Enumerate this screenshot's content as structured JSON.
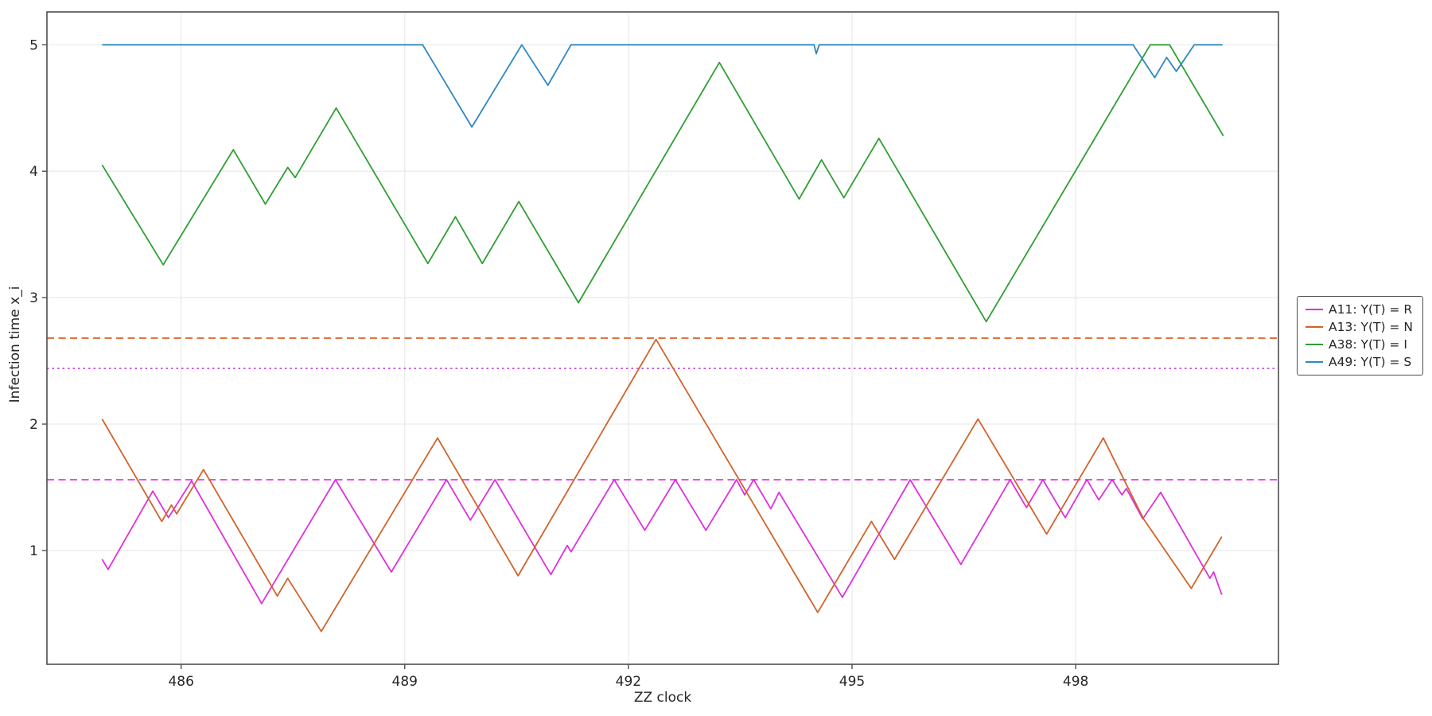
{
  "chart_data": {
    "type": "line",
    "title": "",
    "xlabel": "ZZ clock",
    "ylabel": "Infection time x_i",
    "xlim": [
      484.2,
      500.72
    ],
    "ylim": [
      0.1,
      5.26
    ],
    "xticks": [
      486,
      489,
      492,
      495,
      498
    ],
    "yticks": [
      1,
      2,
      3,
      4,
      5
    ],
    "grid": true,
    "legend_position": "right-outside",
    "colors": {
      "grid": "#e9e9e9",
      "axes_border": "#4d4d4d",
      "tick": "#4d4d4d",
      "text": "#262626"
    },
    "ref_lines": [
      {
        "y": 2.68,
        "color": "#da6227",
        "style": "dashed"
      },
      {
        "y": 2.44,
        "color": "#c44fdd",
        "style": "dotted"
      },
      {
        "y": 1.56,
        "color": "#e437e4",
        "style": "dashed"
      }
    ],
    "series": [
      {
        "name": "A11: Y(T) = R",
        "color": "#de30de",
        "points": [
          [
            484.94,
            0.93
          ],
          [
            485.02,
            0.85
          ],
          [
            485.62,
            1.47
          ],
          [
            485.83,
            1.26
          ],
          [
            486.14,
            1.55
          ],
          [
            487.08,
            0.58
          ],
          [
            488.07,
            1.56
          ],
          [
            488.82,
            0.83
          ],
          [
            489.56,
            1.56
          ],
          [
            489.88,
            1.24
          ],
          [
            490.21,
            1.56
          ],
          [
            490.96,
            0.81
          ],
          [
            491.18,
            1.04
          ],
          [
            491.23,
            0.99
          ],
          [
            491.81,
            1.56
          ],
          [
            492.22,
            1.16
          ],
          [
            492.63,
            1.56
          ],
          [
            493.04,
            1.16
          ],
          [
            493.45,
            1.56
          ],
          [
            493.56,
            1.44
          ],
          [
            493.68,
            1.56
          ],
          [
            493.91,
            1.33
          ],
          [
            494.02,
            1.46
          ],
          [
            494.87,
            0.63
          ],
          [
            495.78,
            1.56
          ],
          [
            496.46,
            0.89
          ],
          [
            497.12,
            1.56
          ],
          [
            497.34,
            1.34
          ],
          [
            497.56,
            1.56
          ],
          [
            497.86,
            1.26
          ],
          [
            498.15,
            1.56
          ],
          [
            498.31,
            1.4
          ],
          [
            498.49,
            1.56
          ],
          [
            498.62,
            1.44
          ],
          [
            498.68,
            1.49
          ],
          [
            498.9,
            1.25
          ],
          [
            499.14,
            1.46
          ],
          [
            499.8,
            0.78
          ],
          [
            499.85,
            0.83
          ],
          [
            499.96,
            0.65
          ]
        ]
      },
      {
        "name": "A13: Y(T) = N",
        "color": "#d2622a",
        "points": [
          [
            484.94,
            2.04
          ],
          [
            485.74,
            1.23
          ],
          [
            485.87,
            1.36
          ],
          [
            485.94,
            1.29
          ],
          [
            486.3,
            1.64
          ],
          [
            487.29,
            0.64
          ],
          [
            487.43,
            0.78
          ],
          [
            487.88,
            0.36
          ],
          [
            489.44,
            1.89
          ],
          [
            490.52,
            0.8
          ],
          [
            492.37,
            2.67
          ],
          [
            494.54,
            0.51
          ],
          [
            495.26,
            1.23
          ],
          [
            495.57,
            0.93
          ],
          [
            496.69,
            2.04
          ],
          [
            497.61,
            1.13
          ],
          [
            498.37,
            1.89
          ],
          [
            498.91,
            1.25
          ],
          [
            499.55,
            0.7
          ],
          [
            499.96,
            1.11
          ]
        ]
      },
      {
        "name": "A38: Y(T) = I",
        "color": "#2f9e33",
        "points": [
          [
            484.94,
            4.05
          ],
          [
            485.76,
            3.26
          ],
          [
            486.7,
            4.17
          ],
          [
            487.13,
            3.74
          ],
          [
            487.43,
            4.03
          ],
          [
            487.53,
            3.95
          ],
          [
            488.08,
            4.5
          ],
          [
            489.31,
            3.27
          ],
          [
            489.68,
            3.64
          ],
          [
            490.04,
            3.27
          ],
          [
            490.53,
            3.76
          ],
          [
            491.33,
            2.96
          ],
          [
            493.22,
            4.86
          ],
          [
            494.29,
            3.78
          ],
          [
            494.59,
            4.09
          ],
          [
            494.89,
            3.79
          ],
          [
            495.36,
            4.26
          ],
          [
            496.8,
            2.81
          ],
          [
            499.0,
            5.0
          ],
          [
            499.26,
            5.0
          ],
          [
            499.98,
            4.28
          ]
        ]
      },
      {
        "name": "A49: Y(T) = S",
        "color": "#2e87c3",
        "points": [
          [
            484.94,
            5.0
          ],
          [
            489.24,
            5.0
          ],
          [
            489.9,
            4.35
          ],
          [
            490.57,
            5.0
          ],
          [
            490.92,
            4.68
          ],
          [
            491.23,
            5.0
          ],
          [
            494.49,
            5.0
          ],
          [
            494.52,
            4.93
          ],
          [
            494.56,
            5.0
          ],
          [
            498.77,
            5.0
          ],
          [
            499.06,
            4.74
          ],
          [
            499.22,
            4.9
          ],
          [
            499.35,
            4.79
          ],
          [
            499.59,
            5.0
          ],
          [
            499.97,
            5.0
          ]
        ]
      }
    ]
  }
}
